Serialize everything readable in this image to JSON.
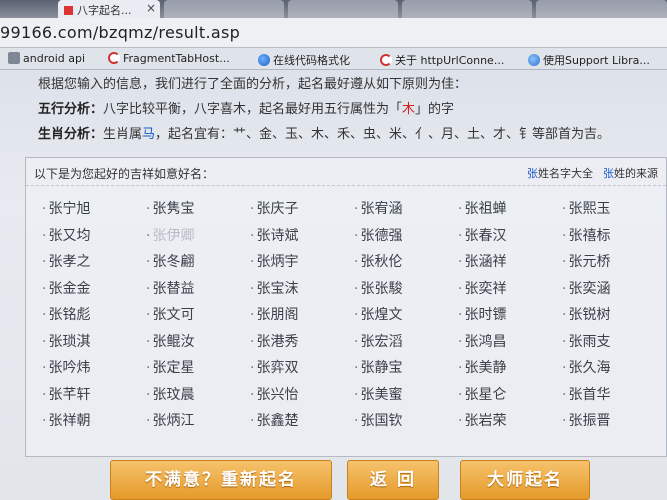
{
  "browser": {
    "tabs": [
      {
        "label": "八字起名..."
      },
      {
        "label": ""
      },
      {
        "label": ""
      },
      {
        "label": ""
      },
      {
        "label": ""
      }
    ],
    "url": "99166.com/bzqmz/result.asp",
    "bookmarks": [
      {
        "label": "android api",
        "icon": "doc-icon"
      },
      {
        "label": "FragmentTabHost...",
        "icon": "c-icon"
      },
      {
        "label": "在线代码格式化",
        "icon": "globe-icon"
      },
      {
        "label": "关于 httpUrlConne...",
        "icon": "c-icon"
      },
      {
        "label": "使用Support Libra...",
        "icon": "ie-icon"
      }
    ]
  },
  "content": {
    "intro": "根据您输入的信息，我们进行了全面的分析，起名最好遵从如下原则为佳：",
    "wuxing": {
      "label": "五行分析：",
      "text_before": "八字比较平衡，八字喜木，起名最好用五行属性为「",
      "element": "木",
      "text_after": "」的字"
    },
    "shengxiao": {
      "label": "生肖分析：",
      "text_before": "生肖属",
      "animal": "马",
      "text_after": "，起名宜有：艹、金、玉、木、禾、虫、米、亻、月、土、才、钅等部首为吉。"
    },
    "names_box": {
      "title": "以下是为您起好的吉祥如意好名：",
      "link1_surname": "张",
      "link1_rest": "姓名字大全",
      "link2_surname": "张",
      "link2_rest": "姓的来源",
      "names": [
        "张宁旭",
        "张隽宝",
        "张庆子",
        "张宥涵",
        "张祖蝉",
        "张熙玉",
        "张又均",
        "张伊卿",
        "张诗斌",
        "张德强",
        "张春汉",
        "张禧标",
        "张孝之",
        "张冬翩",
        "张炳宇",
        "张秋伦",
        "张涵祥",
        "张元桥",
        "张金金",
        "张替益",
        "张宝沫",
        "张张駿",
        "张奕祥",
        "张奕涵",
        "张铭彪",
        "张文可",
        "张朋阁",
        "张煌文",
        "张时镖",
        "张锐树",
        "张琐淇",
        "张鲲汝",
        "张港秀",
        "张宏滔",
        "张鸿昌",
        "张雨支",
        "张吟炜",
        "张定星",
        "张弈双",
        "张静宝",
        "张美静",
        "张久海",
        "张芊轩",
        "张玟晨",
        "张兴怡",
        "张美蜜",
        "张星仑",
        "张首华",
        "张祥朝",
        "张炳江",
        "张鑫楚",
        "张国钦",
        "张岩荣",
        "张振晋"
      ]
    },
    "buttons": {
      "regenerate": "不满意？重新起名",
      "back": "返 回",
      "master": "大师起名"
    }
  }
}
